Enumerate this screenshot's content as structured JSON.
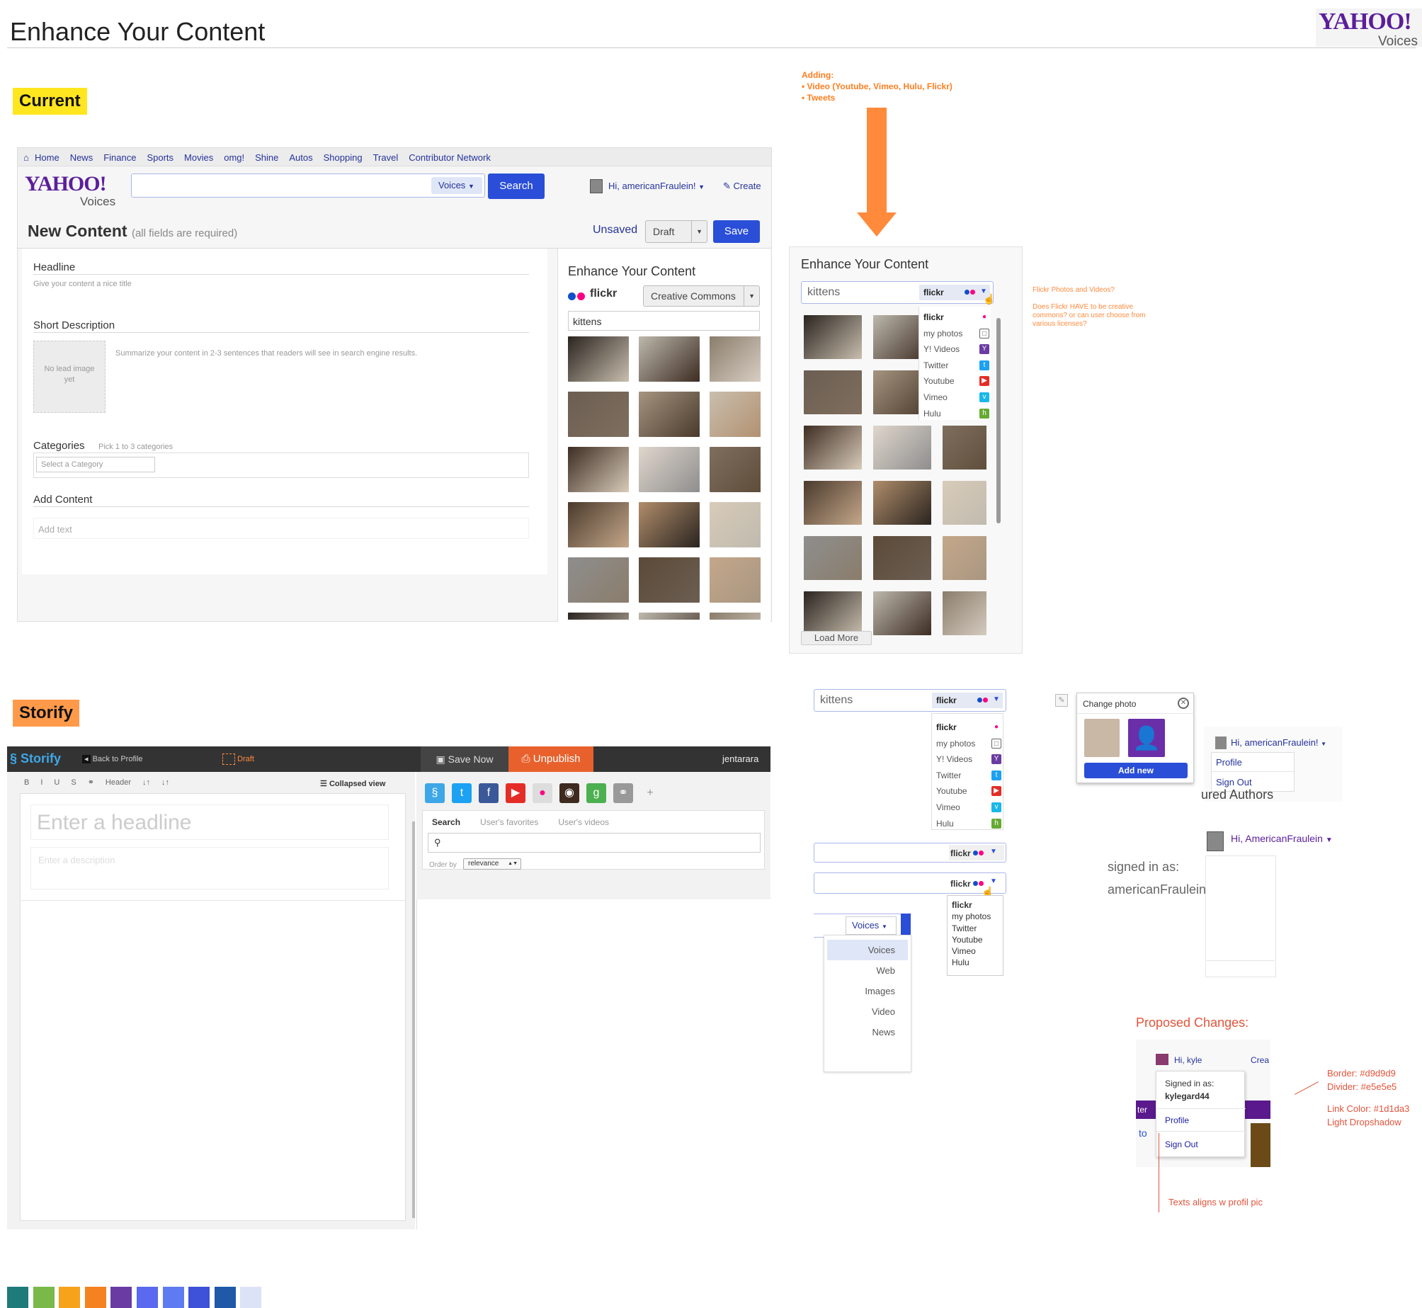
{
  "page": {
    "title": "Enhance Your Content"
  },
  "brand": {
    "logo": "YAHOO!",
    "sub": "Voices"
  },
  "sections": {
    "current": "Current",
    "storify": "Storify"
  },
  "nav": [
    "Home",
    "News",
    "Finance",
    "Sports",
    "Movies",
    "omg!",
    "Shine",
    "Autos",
    "Shopping",
    "Travel",
    "Contributor Network"
  ],
  "header": {
    "voices_select": "Voices",
    "search_btn": "Search",
    "greeting": "Hi, americanFraulein!",
    "create": "Create"
  },
  "editor": {
    "title": "New Content",
    "subtitle": "(all fields are required)",
    "unsaved": "Unsaved",
    "draft": "Draft",
    "save": "Save",
    "headline": "Headline",
    "headline_hint": "Give your content a nice title",
    "short_desc": "Short Description",
    "short_desc_hint": "Summarize your content in 2-3 sentences that readers will see in search engine results.",
    "no_image": "No lead image yet",
    "categories": "Categories",
    "categories_hint": "Pick 1 to 3 categories",
    "select_category": "Select a Category",
    "add_content": "Add Content",
    "add_text": "Add text"
  },
  "enhance": {
    "title": "Enhance Your Content",
    "flickr": "flickr",
    "license": "Creative Commons",
    "query": "kittens"
  },
  "adding_note": {
    "title": "Adding:",
    "line1": "• Video (Youtube, Vimeo, Hulu, Flickr)",
    "line2": "• Tweets"
  },
  "enhance2": {
    "title": "Enhance Your Content",
    "query": "kittens",
    "source": "flickr",
    "load_more": "Load More"
  },
  "sources": [
    "flickr",
    "my photos",
    "Y! Videos",
    "Twitter",
    "Youtube",
    "Vimeo",
    "Hulu"
  ],
  "sources_short": [
    "flickr",
    "my photos",
    "Twitter",
    "Youtube",
    "Vimeo",
    "Hulu"
  ],
  "questions": {
    "q1": "Flickr Photos and Videos?",
    "q2": "Does Flickr HAVE to be creative commons? or can user choose from various licenses?"
  },
  "voices_menu": {
    "selected": "Voices",
    "items": [
      "Voices",
      "Web",
      "Images",
      "Video",
      "News"
    ]
  },
  "change_photo": {
    "title": "Change photo",
    "add_new": "Add new"
  },
  "account_menu": {
    "greeting": "Hi, americanFraulein!",
    "profile": "Profile",
    "signout": "Sign Out",
    "behind": "ured Authors"
  },
  "account2": {
    "greeting": "Hi, AmericanFraulein",
    "signed_in": "signed in as:",
    "user": "americanFraulein"
  },
  "proposed": {
    "title": "Proposed Changes:",
    "greeting": "Hi, kyle",
    "create": "Crea",
    "signed_in": "Signed in as:",
    "user": "kylegard44",
    "profile": "Profile",
    "signout": "Sign Out",
    "side1": "ter",
    "side2": "to",
    "note_border": "Border: #d9d9d9",
    "note_divider": "Divider: #e5e5e5",
    "note_link": "Link Color: #1d1da3",
    "note_shadow": "Light Dropshadow",
    "note_align": "Texts aligns w profil pic"
  },
  "storify": {
    "brand": "Storify",
    "back": "Back to Profile",
    "draft": "Draft",
    "save_now": "Save Now",
    "unpublish": "Unpublish",
    "user": "jentarara",
    "toolbar": [
      "B",
      "I",
      "U",
      "S",
      "⚭",
      "Header",
      "↓↑",
      "↓↑"
    ],
    "collapsed": "Collapsed view",
    "headline_ph": "Enter a headline",
    "desc_ph": "Enter a description",
    "tabs": [
      "Search",
      "User's favorites",
      "User's videos"
    ],
    "order_by": "Order by",
    "relevance": "relevance"
  },
  "colors": {
    "accent": "#2a4ed8",
    "brand": "#5b1e9b",
    "note": "#ff7e1f",
    "red": "#e2543b",
    "swatches": [
      "#1f7a7a",
      "#78b94a",
      "#f7a21b",
      "#f58220",
      "#6a3ba3",
      "#5a69f0",
      "#5f7bf2",
      "#3d52d8",
      "#1f59a8",
      "#dce3f7"
    ]
  },
  "icons": [
    "home-icon",
    "search-icon",
    "chevron-down-icon",
    "close-icon",
    "cursor-hand-icon",
    "create-icon",
    "flickr-icon",
    "twitter-icon",
    "youtube-icon",
    "vimeo-icon",
    "hulu-icon",
    "facebook-icon",
    "instagram-icon",
    "google-icon",
    "link-icon",
    "plus-icon"
  ]
}
